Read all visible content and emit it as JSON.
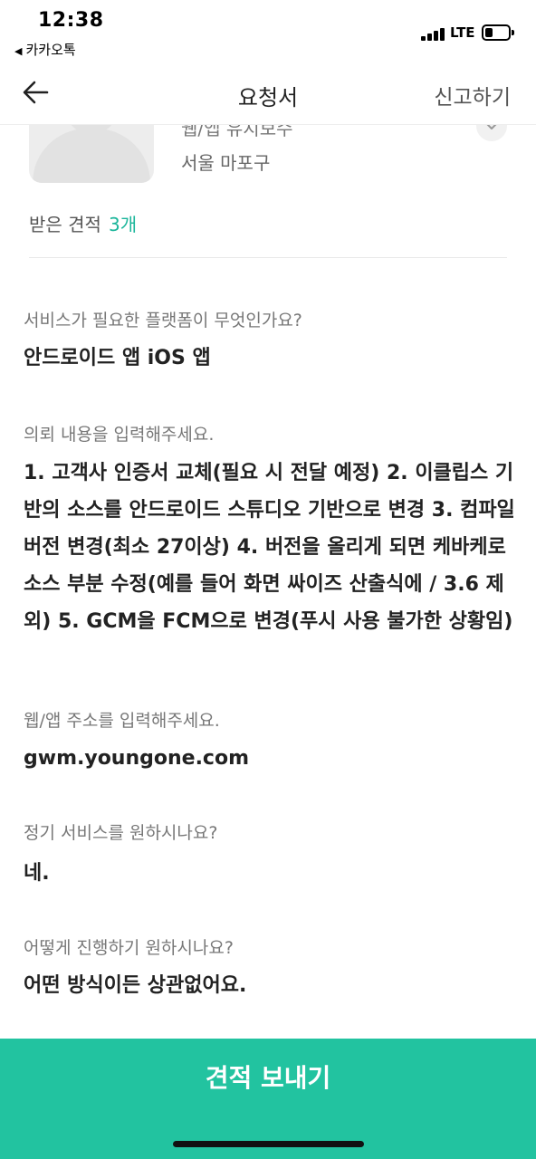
{
  "status_bar": {
    "time": "12:38",
    "back_app": "카카오톡",
    "network": "LTE",
    "icons": [
      "back-triangle-icon",
      "signal-icon",
      "battery-icon"
    ]
  },
  "header": {
    "title": "요청서",
    "report_label": "신고하기",
    "back_icon": "arrow-left-icon"
  },
  "profile": {
    "cut_off_text": "웹/앱 유지보수",
    "region": "서울 마포구",
    "quotes_label": "받은 견적",
    "quotes_count": "3개"
  },
  "qa": [
    {
      "question": "서비스가 필요한 플랫폼이 무엇인가요?",
      "answer": "안드로이드 앱 iOS 앱"
    },
    {
      "question": "의뢰 내용을 입력해주세요.",
      "answer": "1. 고객사 인증서 교체(필요 시 전달 예정)  2. 이클립스 기반의 소스를 안드로이드 스튜디오 기반으로 변경 3. 컴파일 버전 변경(최소 27이상) 4. 버전을 올리게 되면 케바케로 소스 부분 수정(예를 들어 화면 싸이즈 산출식에 / 3.6 제외)  5. GCM을 FCM으로 변경(푸시 사용 불가한 상황임)"
    },
    {
      "question": "웹/앱 주소를 입력해주세요.",
      "answer": "gwm.youngone.com"
    },
    {
      "question": "정기 서비스를 원하시나요?",
      "answer": "네."
    },
    {
      "question": "어떻게 진행하기 원하시나요?",
      "answer": "어떤 방식이든 상관없어요."
    }
  ],
  "cta": {
    "label": "견적 보내기"
  },
  "colors": {
    "accent": "#22c3a0",
    "count": "#1ab59a"
  }
}
